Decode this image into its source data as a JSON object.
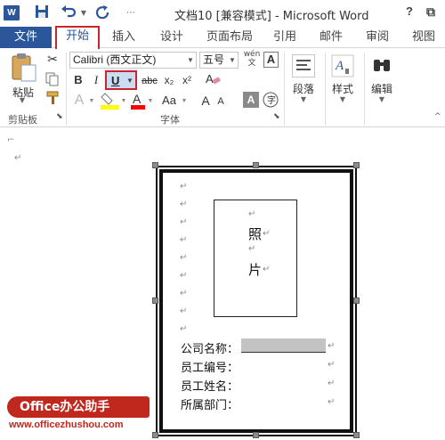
{
  "titlebar": {
    "title": "文档10 [兼容模式] - Microsoft Word",
    "app_badge": "W",
    "help_label": "?",
    "restore_label": "⧉",
    "minimize_label": "—"
  },
  "tabs": [
    {
      "label": "文件"
    },
    {
      "label": "开始"
    },
    {
      "label": "插入"
    },
    {
      "label": "设计"
    },
    {
      "label": "页面布局"
    },
    {
      "label": "引用"
    },
    {
      "label": "邮件"
    },
    {
      "label": "审阅"
    },
    {
      "label": "视图"
    }
  ],
  "ribbon": {
    "clipboard": {
      "group_label": "剪贴板",
      "paste_label": "粘贴"
    },
    "font": {
      "group_label": "字体",
      "font_name": "Calibri (西文正文)",
      "font_size": "五号",
      "bold": "B",
      "italic": "I",
      "underline": "U",
      "strike": "abc",
      "subscript": "x₂",
      "superscript": "x²",
      "grow": "A",
      "shrink": "A",
      "change_case": "Aa",
      "char_shade": "A",
      "wen": "wén"
    },
    "paragraph": {
      "label": "段落"
    },
    "styles": {
      "label": "样式"
    },
    "editing": {
      "label": "编辑"
    }
  },
  "document": {
    "photo_chars": [
      "照",
      "片"
    ],
    "fields": [
      {
        "label": "公司名称："
      },
      {
        "label": "员工编号："
      },
      {
        "label": "员工姓名："
      },
      {
        "label": "所属部门："
      }
    ],
    "para_mark": "↵"
  },
  "watermark": {
    "logo_text": "Office办公助手",
    "url": "www.officezhushou.com"
  },
  "colors": {
    "accent": "#2b579a",
    "highlight_box": "#c8252c",
    "text_highlight": "#ffff00",
    "font_color": "#ff0000"
  }
}
